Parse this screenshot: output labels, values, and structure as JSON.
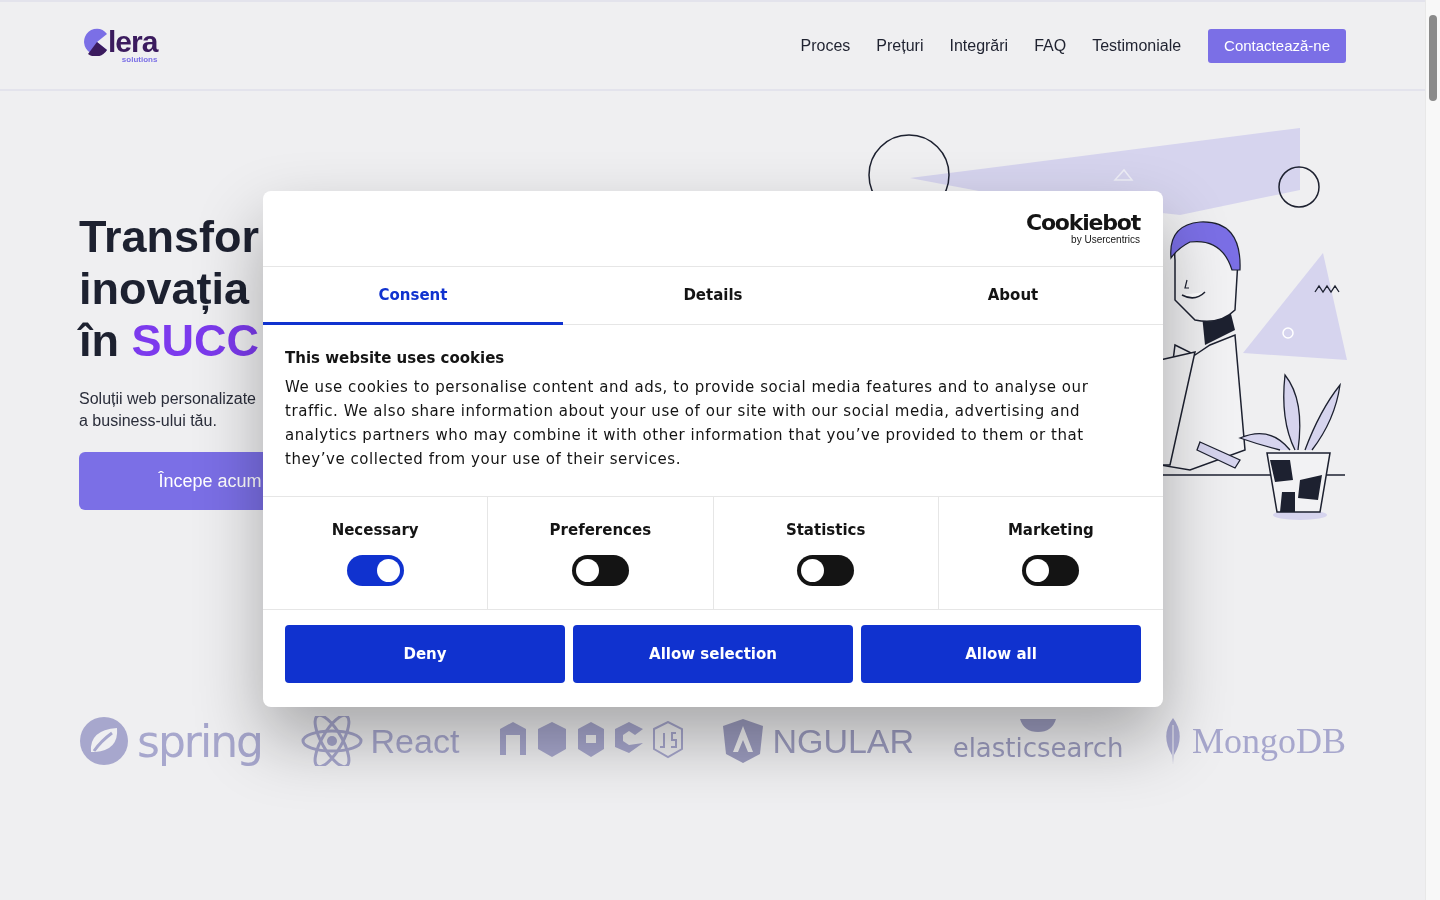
{
  "header": {
    "logo": {
      "wordmark": "lera",
      "tagline": "solutions"
    },
    "nav": [
      {
        "label": "Proces"
      },
      {
        "label": "Prețuri"
      },
      {
        "label": "Integrări"
      },
      {
        "label": "FAQ"
      },
      {
        "label": "Testimoniale"
      }
    ],
    "cta": "Contactează-ne"
  },
  "hero": {
    "heading": [
      [
        {
          "text": "Transfor",
          "accent": false
        }
      ],
      [
        {
          "text": "inovația",
          "accent": false
        }
      ],
      [
        {
          "text": "în ",
          "accent": false
        },
        {
          "text": "SUCC",
          "accent": true
        }
      ]
    ],
    "subtitle": [
      "Soluții web personalizate",
      "a business-ului tău."
    ],
    "button": "Începe acum"
  },
  "technologies": [
    {
      "kind": "spring",
      "label": "spring"
    },
    {
      "kind": "react",
      "label": "React"
    },
    {
      "kind": "node"
    },
    {
      "kind": "angular",
      "label": "NGULAR"
    },
    {
      "kind": "elasticsearch",
      "label": "elasticsearch"
    },
    {
      "kind": "mongodb",
      "label": "MongoDB"
    }
  ],
  "consent": {
    "brand": {
      "name": "Cookiebot",
      "byline": "by Usercentrics"
    },
    "tabs": [
      {
        "label": "Consent",
        "selected": true
      },
      {
        "label": "Details",
        "selected": false
      },
      {
        "label": "About",
        "selected": false
      }
    ],
    "title": "This website uses cookies",
    "body": "We use cookies to personalise content and ads, to provide social media features and to analyse our traffic. We also share information about your use of our site with our social media, advertising and analytics partners who may combine it with other information that you’ve provided to them or that they’ve collected from your use of their services.",
    "toggles": [
      {
        "label": "Necessary",
        "on": true
      },
      {
        "label": "Preferences",
        "on": false
      },
      {
        "label": "Statistics",
        "on": false
      },
      {
        "label": "Marketing",
        "on": false
      }
    ],
    "buttons": [
      "Deny",
      "Allow selection",
      "Allow all"
    ]
  }
}
